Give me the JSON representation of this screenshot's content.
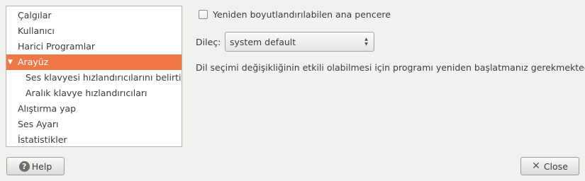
{
  "sidebar": {
    "items": [
      {
        "label": "Çalgılar"
      },
      {
        "label": "Kullanıcı"
      },
      {
        "label": "Harici Programlar"
      },
      {
        "label": "Arayüz",
        "selected": true,
        "expanded": true
      },
      {
        "label": "Ses klavyesi hızlandırıcılarını belirtin"
      },
      {
        "label": "Aralık klavye hızlandırıcıları"
      },
      {
        "label": "Alıştırma yap"
      },
      {
        "label": "Ses Ayarı"
      },
      {
        "label": "İstatistikler"
      }
    ]
  },
  "main": {
    "resizable_checkbox": {
      "label": "Yeniden boyutlandırılabilen ana pencere",
      "checked": false
    },
    "language": {
      "label": "Dileç:",
      "value": "system default"
    },
    "restart_note": "Dil seçimi değişikliğinin etkili olabilmesi için programı yeniden başlatmanız gerekmektedir."
  },
  "buttons": {
    "help": {
      "label": "Help",
      "icon": "help-icon"
    },
    "close": {
      "label": "Close",
      "icon": "close-icon"
    }
  },
  "colors": {
    "selection": "#f07746",
    "window_bg": "#f2f1f0"
  }
}
